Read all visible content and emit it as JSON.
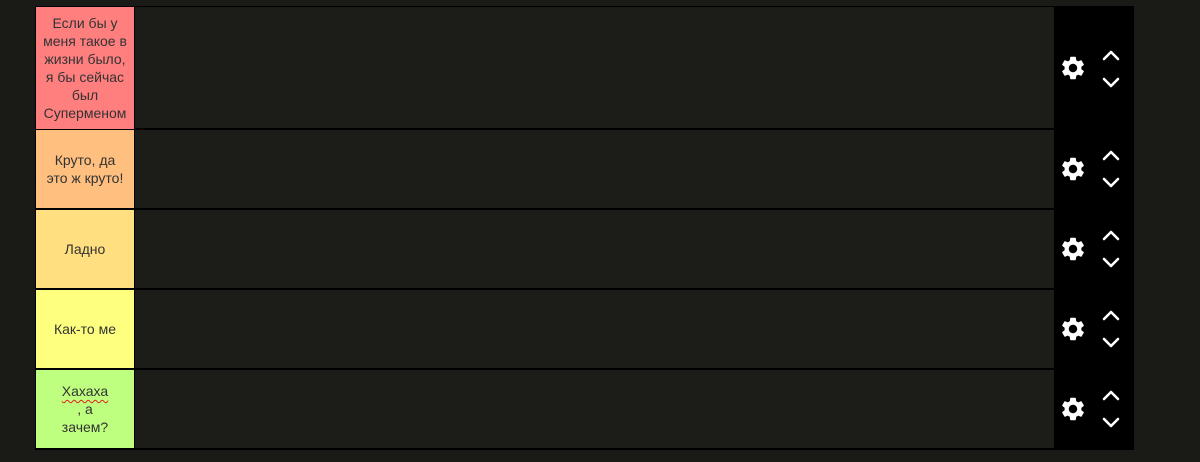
{
  "tiers": [
    {
      "label_lines": [
        "Если бы у",
        "меня такое в",
        "жизни было,",
        "я бы сейчас",
        "был",
        "Суперменом"
      ],
      "color": "#ff7f7f",
      "gear_icon": "gear-icon",
      "up_icon": "chevron-up-icon",
      "down_icon": "chevron-down-icon"
    },
    {
      "label_lines": [
        "Круто, да",
        "это ж круто!"
      ],
      "color": "#ffbf7f",
      "gear_icon": "gear-icon",
      "up_icon": "chevron-up-icon",
      "down_icon": "chevron-down-icon"
    },
    {
      "label_lines": [
        "Ладно"
      ],
      "color": "#ffdf7f",
      "gear_icon": "gear-icon",
      "up_icon": "chevron-up-icon",
      "down_icon": "chevron-down-icon"
    },
    {
      "label_lines": [
        "Как-то ме"
      ],
      "color": "#ffff7f",
      "gear_icon": "gear-icon",
      "up_icon": "chevron-up-icon",
      "down_icon": "chevron-down-icon"
    },
    {
      "label_line1_word": "Хахаха",
      "label_line1_rest": ", а",
      "label_line2": "зачем?",
      "color": "#bfff7f",
      "spellcheck_flagged_word": "Хахаха",
      "gear_icon": "gear-icon",
      "up_icon": "chevron-up-icon",
      "down_icon": "chevron-down-icon"
    }
  ]
}
